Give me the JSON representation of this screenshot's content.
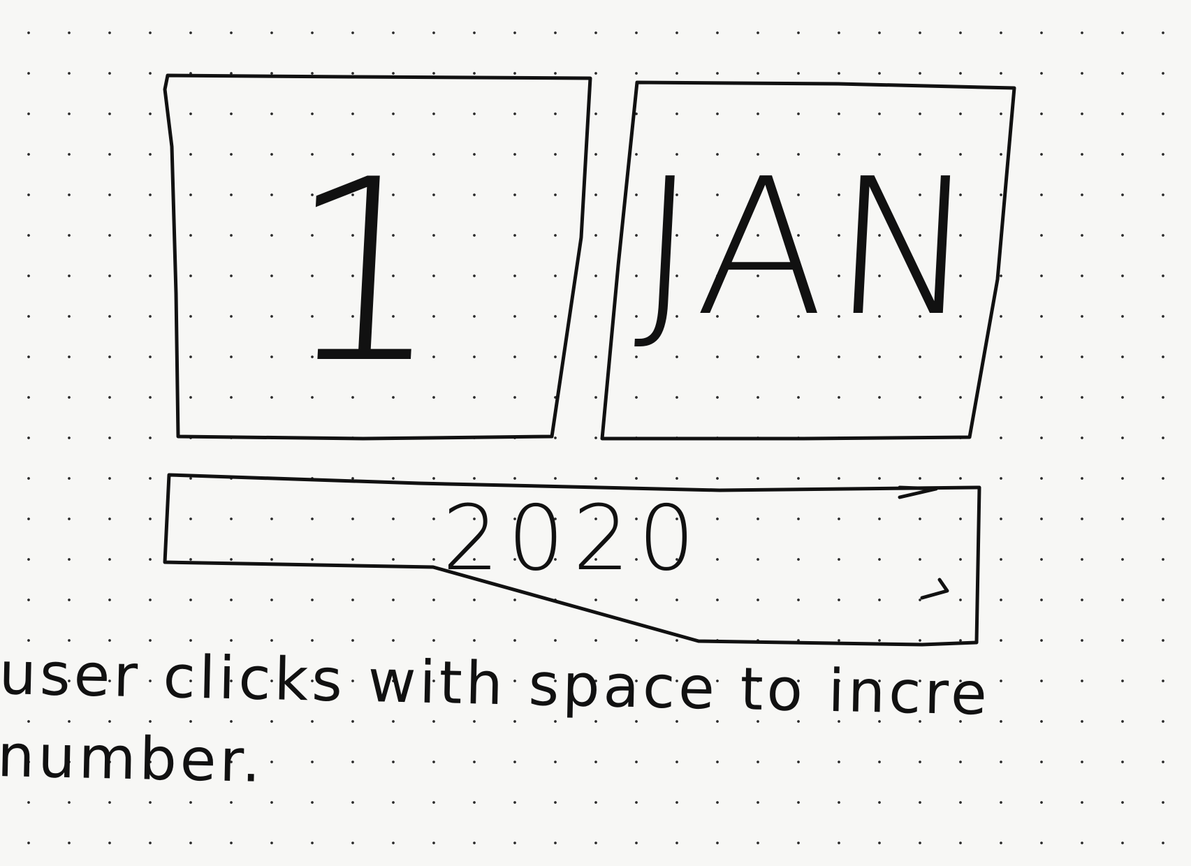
{
  "date_picker": {
    "day": "1",
    "month": "JAN",
    "year": "2020"
  },
  "annotation": {
    "text": "user clicks with space to incre\nnumber."
  }
}
